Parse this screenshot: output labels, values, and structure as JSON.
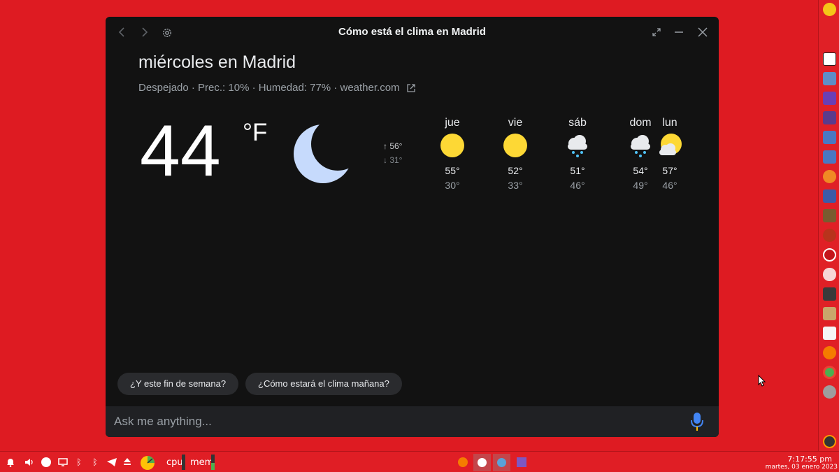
{
  "window": {
    "title": "Cómo está el clima en Madrid",
    "icons": [
      "back-arrow-icon",
      "forward-arrow-icon",
      "gear-icon",
      "expand-icon",
      "minimize-icon",
      "close-icon"
    ]
  },
  "weather": {
    "day_title": "miércoles en Madrid",
    "summary": "Despejado · Prec.: 10% · Humedad: 77% · ",
    "source": "weather.com",
    "temperature": "44",
    "unit": "°F",
    "condition_icon": "moon-icon",
    "high": "↑ 56°",
    "low": "↓ 31°",
    "forecast": [
      {
        "day": "jue",
        "icon": "sun-icon",
        "high": "55°",
        "low": "30°"
      },
      {
        "day": "vie",
        "icon": "sun-icon",
        "high": "52°",
        "low": "33°"
      },
      {
        "day": "sáb",
        "icon": "snow-cloud-icon",
        "high": "51°",
        "low": "46°"
      },
      {
        "day": "dom",
        "icon": "snow-cloud-icon",
        "high": "54°",
        "low": "49°"
      },
      {
        "day": "lun",
        "icon": "partly-cloudy-icon",
        "high": "57°",
        "low": "46°"
      }
    ]
  },
  "suggestions": [
    "¿Y este fin de semana?",
    "¿Cómo estará el clima mañana?"
  ],
  "input": {
    "placeholder": "Ask me anything..."
  },
  "panel": {
    "cpu_label": "cpu",
    "mem_label": "mem",
    "time": "7:17:55 pm",
    "date": "martes, 03 enero 2023"
  },
  "colors": {
    "desktop": "#de1b22",
    "window_bg": "#121212",
    "sun": "#fdd835",
    "moon": "#c6dafc",
    "mic_blue": "#4285f4",
    "mic_orange": "#fbbc04"
  }
}
